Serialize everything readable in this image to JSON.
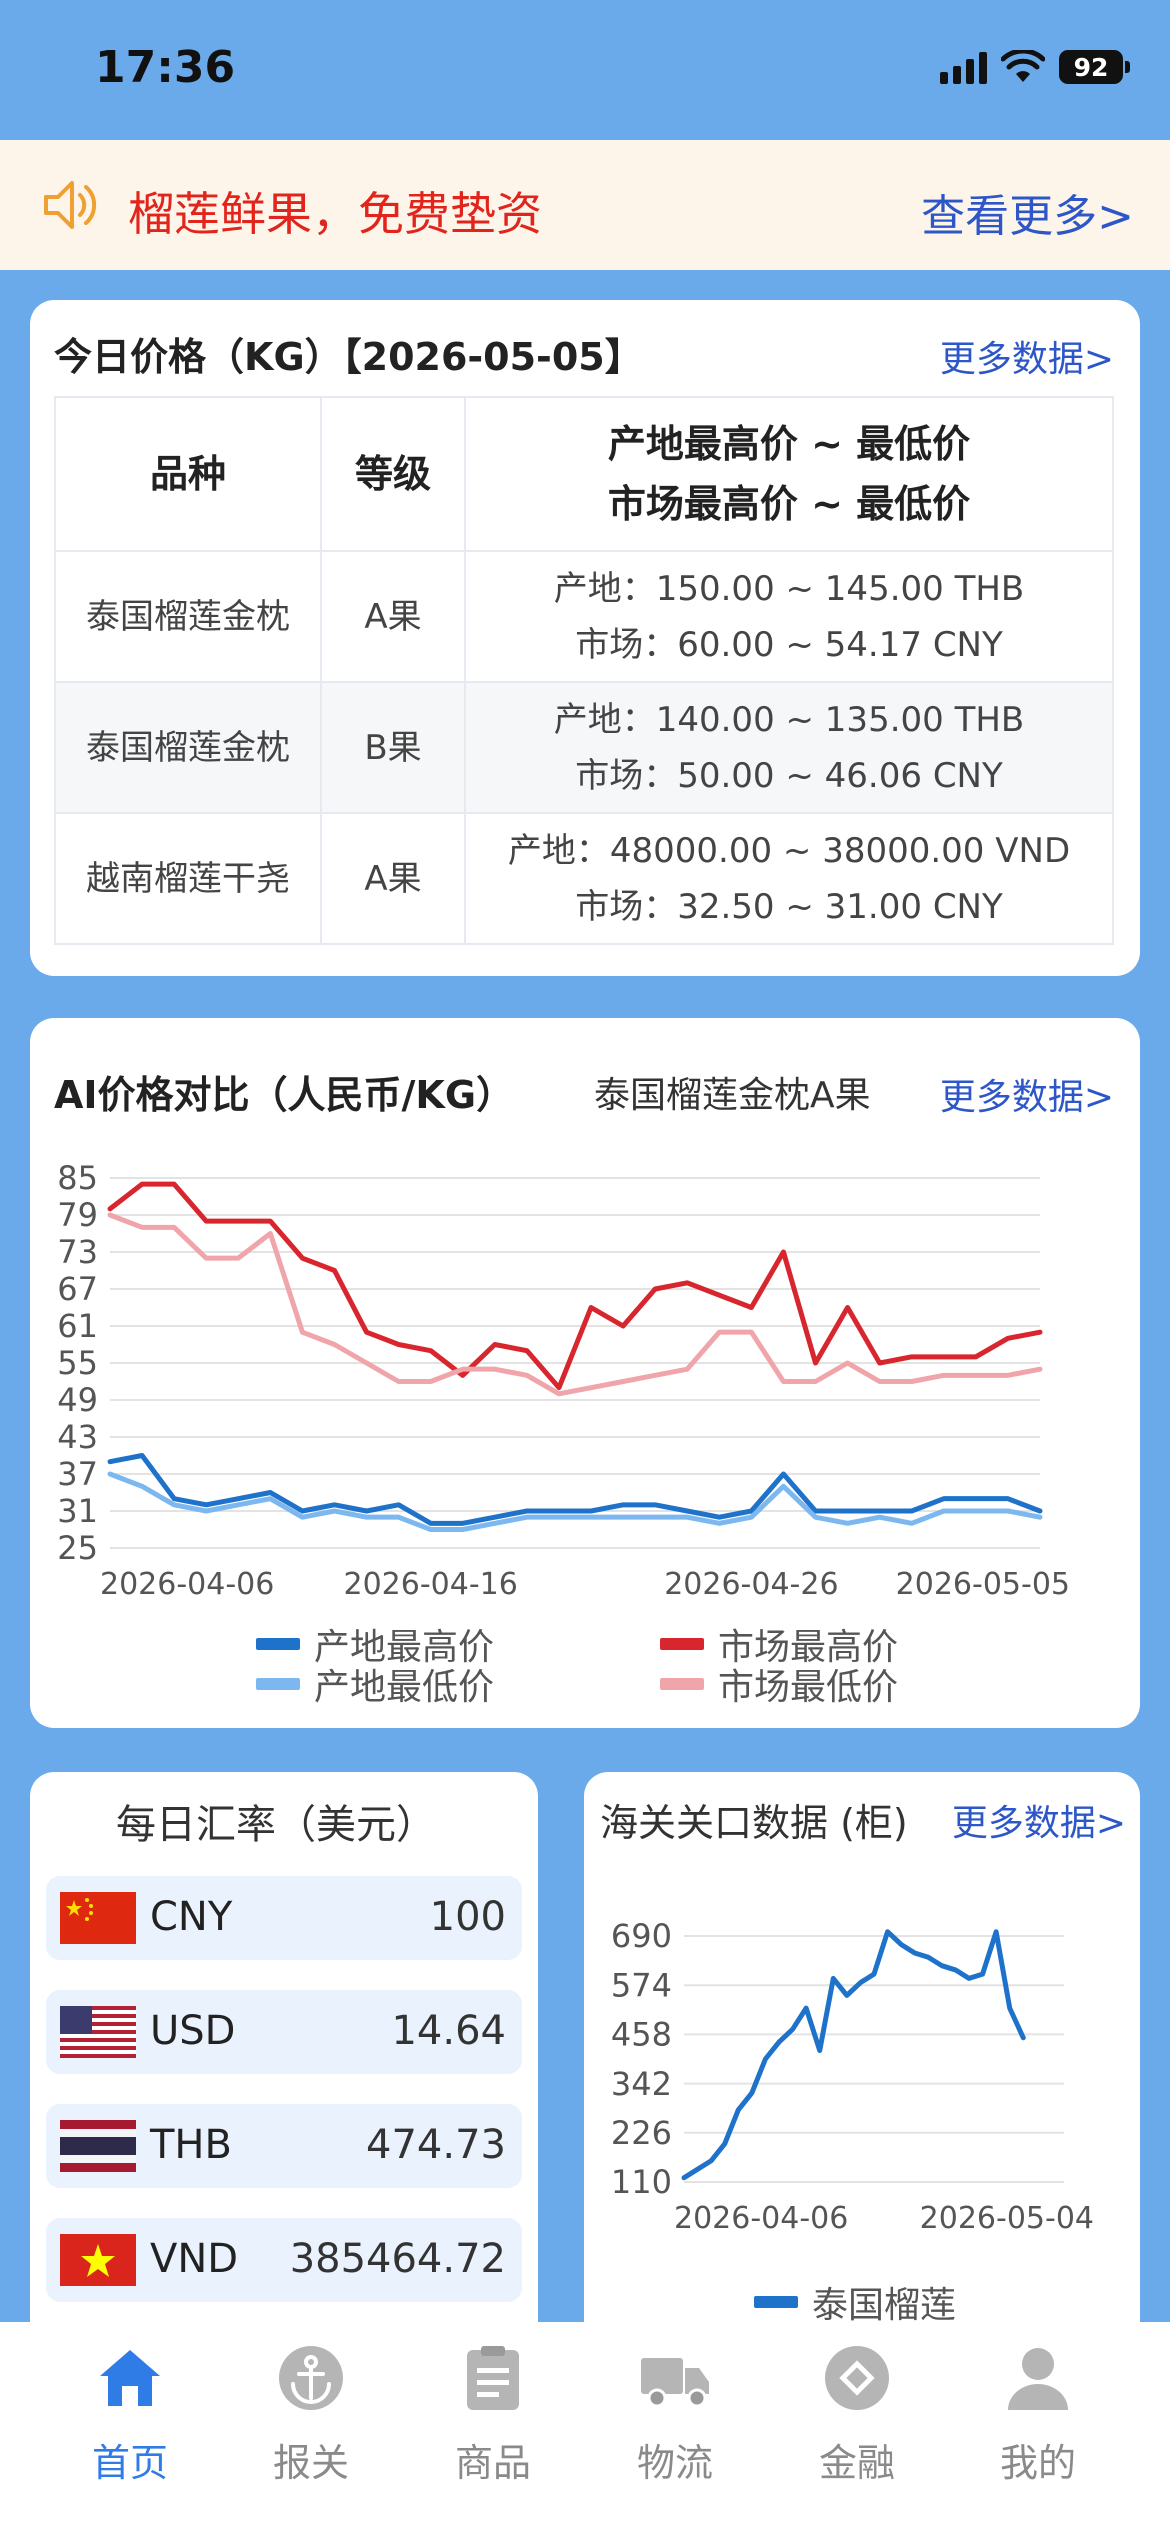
{
  "status_bar": {
    "time": "17:36",
    "battery": "92"
  },
  "notice": {
    "text": "榴莲鲜果，免费垫资",
    "more": "查看更多>"
  },
  "today_price": {
    "title": "今日价格（KG）【2026-05-05】",
    "more": "更多数据>",
    "headers": [
      "品种",
      "等级",
      "产地最高价 ~ 最低价",
      "市场最高价 ~ 最低价"
    ],
    "rows": [
      {
        "variety": "泰国榴莲金枕",
        "grade": "A果",
        "origin": "产地：150.00 ~ 145.00 THB",
        "market": "市场：60.00 ~ 54.17 CNY"
      },
      {
        "variety": "泰国榴莲金枕",
        "grade": "B果",
        "origin": "产地：140.00 ~ 135.00 THB",
        "market": "市场：50.00 ~ 46.06 CNY"
      },
      {
        "variety": "越南榴莲干尧",
        "grade": "A果",
        "origin": "产地：48000.00 ~ 38000.00 VND",
        "market": "市场：32.50 ~ 31.00 CNY"
      }
    ]
  },
  "ai_price": {
    "title": "AI价格对比（人民币/KG）",
    "product": "泰国榴莲金枕A果",
    "more": "更多数据>",
    "legend": [
      "产地最高价",
      "市场最高价",
      "产地最低价",
      "市场最低价"
    ]
  },
  "fx": {
    "title": "每日汇率（美元）",
    "rows": [
      {
        "code": "CNY",
        "value": "100"
      },
      {
        "code": "USD",
        "value": "14.64"
      },
      {
        "code": "THB",
        "value": "474.73"
      },
      {
        "code": "VND",
        "value": "385464.72"
      }
    ]
  },
  "customs": {
    "title": "海关关口数据 (柜)",
    "more": "更多数据>",
    "legend": "泰国榴莲"
  },
  "tabs": [
    {
      "label": "首页",
      "icon": "home-icon",
      "active": true
    },
    {
      "label": "报关",
      "icon": "anchor-icon",
      "active": false
    },
    {
      "label": "商品",
      "icon": "clipboard-icon",
      "active": false
    },
    {
      "label": "物流",
      "icon": "truck-icon",
      "active": false
    },
    {
      "label": "金融",
      "icon": "finance-icon",
      "active": false
    },
    {
      "label": "我的",
      "icon": "user-icon",
      "active": false
    }
  ],
  "colors": {
    "background": "#6aaaea",
    "accent_blue": "#2d56c8",
    "notice_red": "#e2251c",
    "origin_high": "#1f72c9",
    "origin_low": "#7cb8ef",
    "market_high": "#d8262e",
    "market_low": "#f0a5aa",
    "tab_active": "#2f7ce6"
  },
  "chart_data": [
    {
      "type": "line",
      "title": "AI价格对比（人民币/KG）",
      "ylim": [
        25,
        85
      ],
      "yticks": [
        85,
        79,
        73,
        67,
        61,
        55,
        49,
        43,
        37,
        31,
        25
      ],
      "xticks": [
        "2026-04-06",
        "2026-04-16",
        "2026-04-26",
        "2026-05-05"
      ],
      "grid": true,
      "legend_position": "bottom",
      "x": [
        "2026-04-06",
        "2026-04-07",
        "2026-04-08",
        "2026-04-09",
        "2026-04-10",
        "2026-04-11",
        "2026-04-12",
        "2026-04-13",
        "2026-04-14",
        "2026-04-15",
        "2026-04-16",
        "2026-04-17",
        "2026-04-18",
        "2026-04-19",
        "2026-04-20",
        "2026-04-21",
        "2026-04-22",
        "2026-04-23",
        "2026-04-24",
        "2026-04-25",
        "2026-04-26",
        "2026-04-27",
        "2026-04-28",
        "2026-04-29",
        "2026-04-30",
        "2026-05-01",
        "2026-05-02",
        "2026-05-03",
        "2026-05-04",
        "2026-05-05"
      ],
      "series": [
        {
          "name": "产地最高价",
          "values": [
            39,
            40,
            33,
            32,
            33,
            34,
            31,
            32,
            31,
            32,
            29,
            29,
            30,
            31,
            31,
            31,
            32,
            32,
            31,
            30,
            31,
            37,
            31,
            31,
            31,
            31,
            33,
            33,
            33,
            31
          ]
        },
        {
          "name": "市场最高价",
          "values": [
            80,
            84,
            84,
            78,
            78,
            78,
            72,
            70,
            60,
            58,
            57,
            53,
            58,
            57,
            51,
            64,
            61,
            67,
            68,
            66,
            64,
            73,
            55,
            64,
            55,
            56,
            56,
            56,
            59,
            60
          ]
        },
        {
          "name": "产地最低价",
          "values": [
            37,
            35,
            32,
            31,
            32,
            33,
            30,
            31,
            30,
            30,
            28,
            28,
            29,
            30,
            30,
            30,
            30,
            30,
            30,
            29,
            30,
            35,
            30,
            29,
            30,
            29,
            31,
            31,
            31,
            30
          ]
        },
        {
          "name": "市场最低价",
          "values": [
            79,
            77,
            77,
            72,
            72,
            76,
            60,
            58,
            55,
            52,
            52,
            54,
            54,
            53,
            50,
            51,
            52,
            53,
            54,
            60,
            60,
            52,
            52,
            55,
            52,
            52,
            53,
            53,
            53,
            54
          ]
        }
      ]
    },
    {
      "type": "line",
      "title": "海关关口数据 (柜)",
      "ylim": [
        110,
        690
      ],
      "yticks": [
        690,
        574,
        458,
        342,
        226,
        110
      ],
      "xticks": [
        "2026-04-06",
        "2026-05-04"
      ],
      "grid": true,
      "legend_position": "bottom",
      "x": [
        "2026-04-06",
        "2026-04-07",
        "2026-04-08",
        "2026-04-09",
        "2026-04-10",
        "2026-04-11",
        "2026-04-12",
        "2026-04-13",
        "2026-04-14",
        "2026-04-15",
        "2026-04-16",
        "2026-04-17",
        "2026-04-18",
        "2026-04-19",
        "2026-04-20",
        "2026-04-21",
        "2026-04-22",
        "2026-04-23",
        "2026-04-24",
        "2026-04-25",
        "2026-04-26",
        "2026-04-27",
        "2026-04-28",
        "2026-04-29",
        "2026-04-30",
        "2026-05-01",
        "2026-05-02",
        "2026-05-03",
        "2026-05-04"
      ],
      "series": [
        {
          "name": "泰国榴莲",
          "values": [
            120,
            140,
            160,
            200,
            280,
            320,
            400,
            440,
            470,
            520,
            420,
            590,
            550,
            580,
            600,
            700,
            670,
            650,
            640,
            620,
            610,
            590,
            600,
            700,
            520,
            450,
            null,
            null,
            null
          ]
        }
      ]
    }
  ]
}
